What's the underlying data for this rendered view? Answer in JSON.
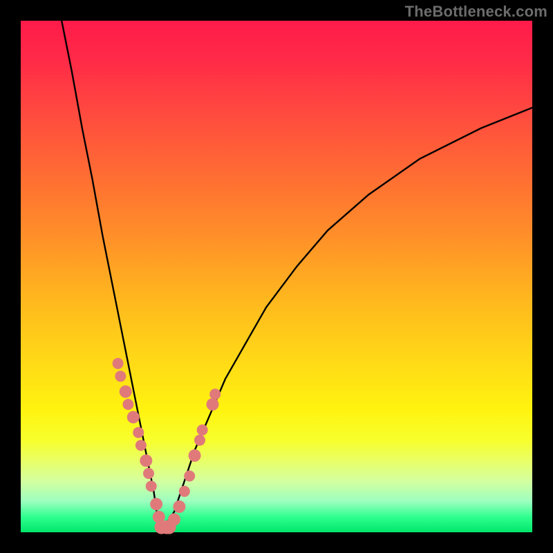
{
  "watermark": "TheBottleneck.com",
  "colors": {
    "curve_stroke": "#000000",
    "marker_fill": "#e07a7a",
    "frame_bg": "#000000"
  },
  "chart_data": {
    "type": "line",
    "title": "",
    "xlabel": "",
    "ylabel": "",
    "xlim": [
      0,
      100
    ],
    "ylim": [
      0,
      100
    ],
    "note": "V-shaped bottleneck curve. x ≈ component balance axis (arbitrary units), y ≈ bottleneck percentage. Curve minimum (~0%) near x≈27; rises steeply both sides. Values estimated from pixel positions against a 100×100 grid.",
    "series": [
      {
        "name": "bottleneck-curve",
        "x": [
          8,
          10,
          12,
          14,
          16,
          18,
          20,
          22,
          24,
          26,
          27,
          28,
          30,
          32,
          34,
          37,
          40,
          44,
          48,
          54,
          60,
          68,
          78,
          90,
          100
        ],
        "y": [
          100,
          90,
          79,
          69,
          58,
          48,
          38,
          28,
          18,
          8,
          1,
          1,
          4,
          10,
          16,
          23,
          30,
          37,
          44,
          52,
          59,
          66,
          73,
          79,
          83
        ]
      }
    ],
    "markers": {
      "name": "highlighted-points",
      "note": "Salmon dots clustered on both arms near the trough and along the bottom.",
      "x": [
        19.0,
        19.5,
        20.5,
        21.0,
        22.0,
        23.0,
        23.5,
        24.5,
        25.0,
        25.5,
        26.5,
        27.0,
        27.5,
        28.5,
        29.0,
        30.0,
        31.0,
        32.0,
        33.0,
        34.0,
        35.0,
        35.5,
        37.5,
        38.0
      ],
      "y": [
        33.0,
        30.5,
        27.5,
        25.0,
        22.5,
        19.5,
        17.0,
        14.0,
        11.5,
        9.0,
        5.5,
        3.0,
        1.0,
        1.0,
        1.0,
        2.5,
        5.0,
        8.0,
        11.0,
        15.0,
        18.0,
        20.0,
        25.0,
        27.0
      ],
      "r": [
        8,
        8,
        9,
        8,
        9,
        8,
        8,
        9,
        8,
        8,
        9,
        9,
        10,
        10,
        10,
        9,
        9,
        8,
        8,
        9,
        8,
        8,
        9,
        8
      ]
    }
  }
}
